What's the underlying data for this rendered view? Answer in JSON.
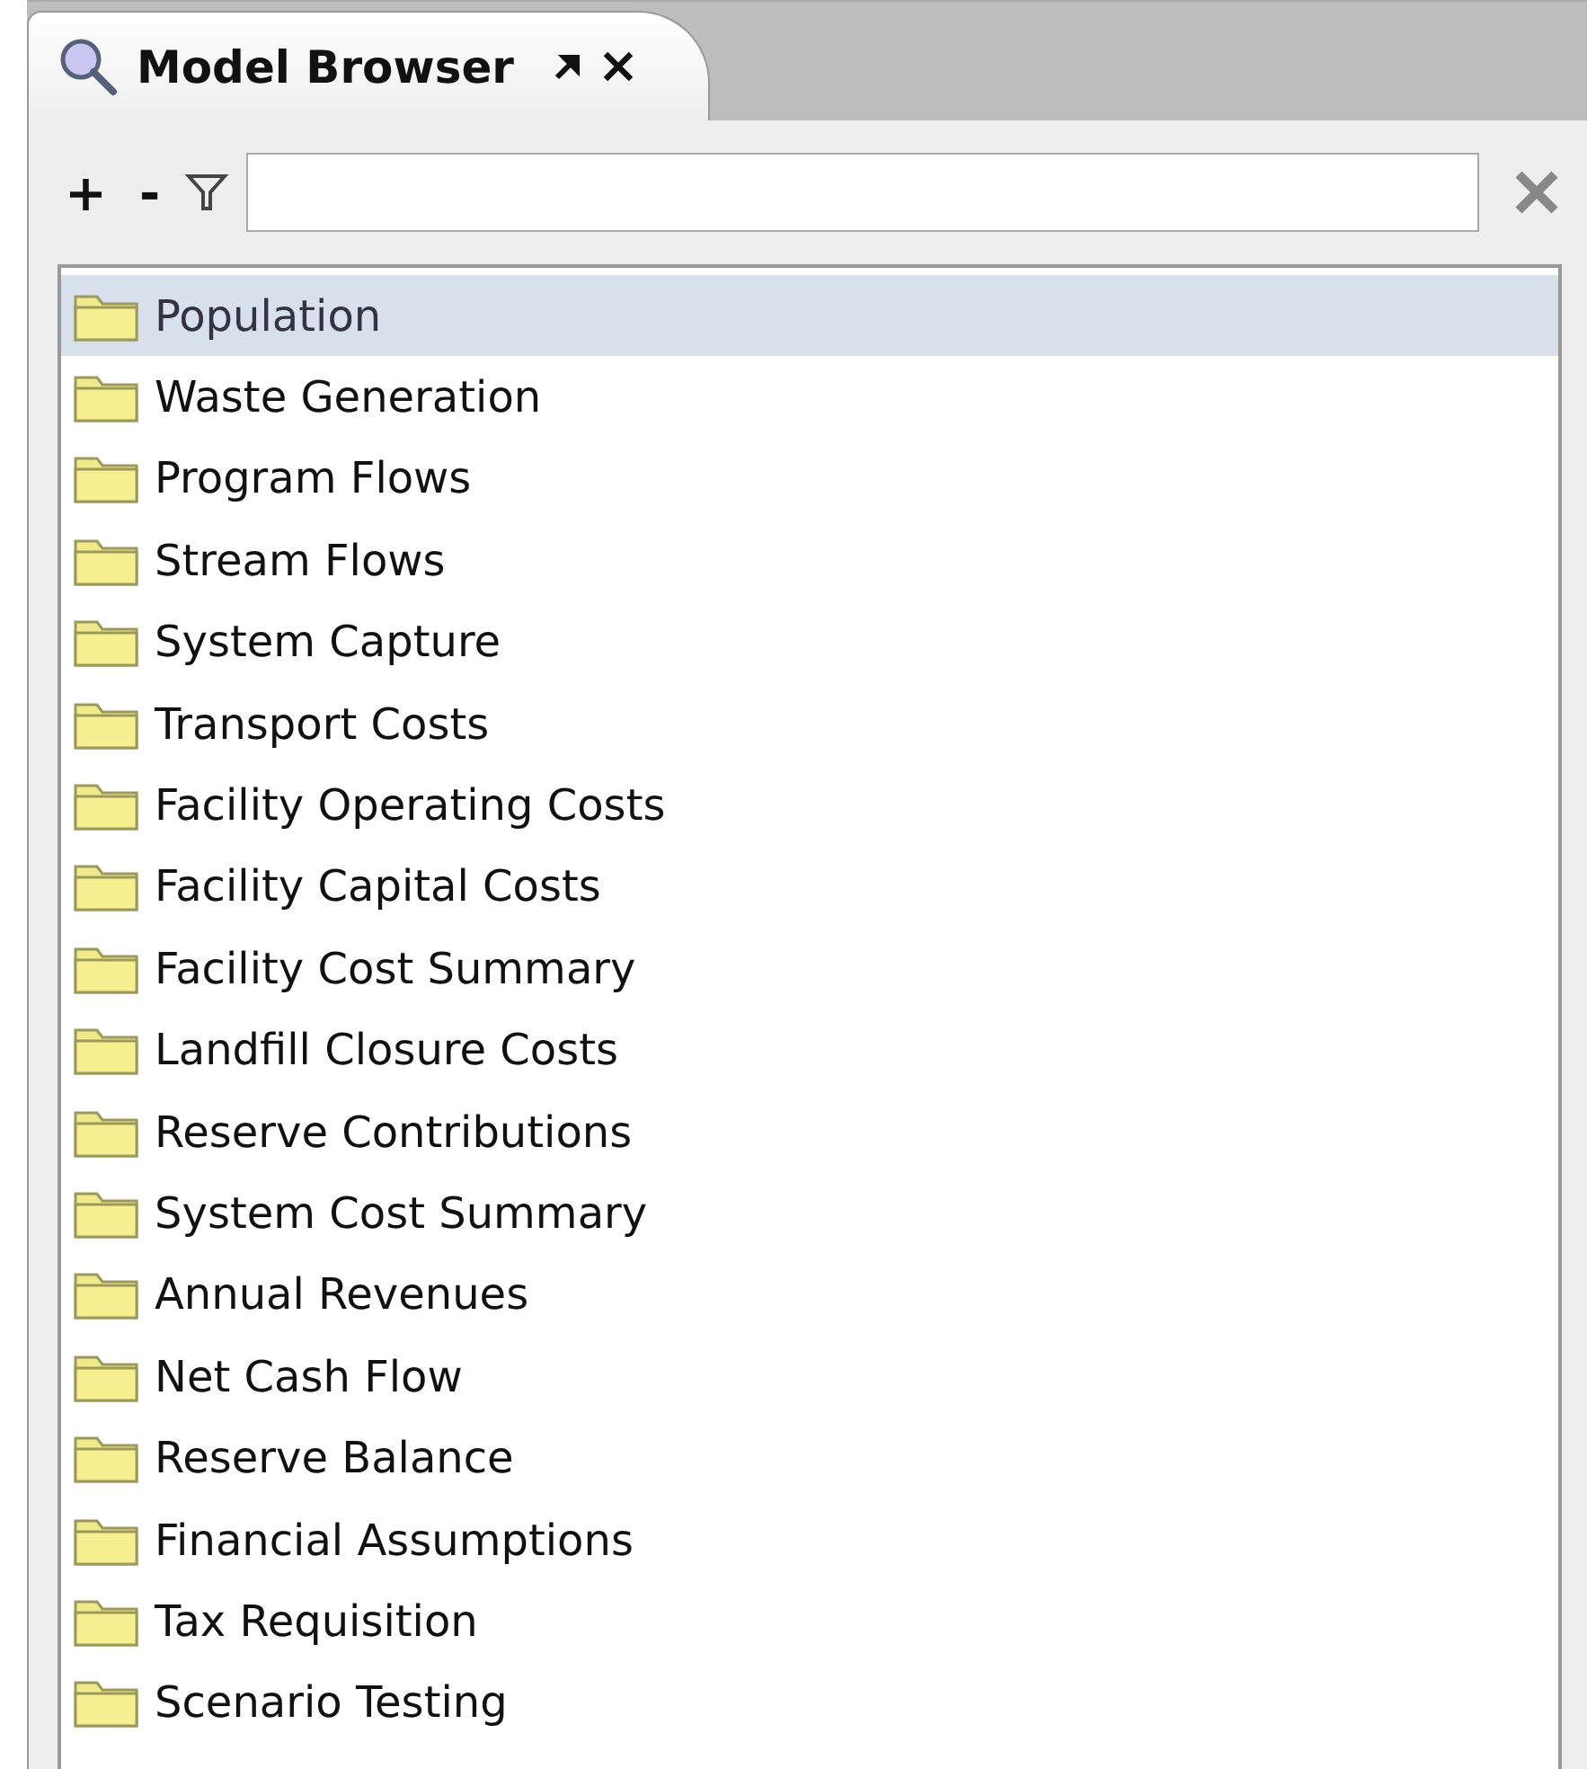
{
  "tab": {
    "title": "Model Browser",
    "selected": true
  },
  "toolbar": {
    "expand": "+",
    "collapse": "-"
  },
  "tree": {
    "items": [
      {
        "label": "Population",
        "selected": true
      },
      {
        "label": "Waste Generation",
        "selected": false
      },
      {
        "label": "Program Flows",
        "selected": false
      },
      {
        "label": "Stream Flows",
        "selected": false
      },
      {
        "label": "System Capture",
        "selected": false
      },
      {
        "label": "Transport Costs",
        "selected": false
      },
      {
        "label": "Facility Operating Costs",
        "selected": false
      },
      {
        "label": "Facility Capital Costs",
        "selected": false
      },
      {
        "label": "Facility Cost Summary",
        "selected": false
      },
      {
        "label": "Landfill Closure Costs",
        "selected": false
      },
      {
        "label": "Reserve Contributions",
        "selected": false
      },
      {
        "label": "System Cost Summary",
        "selected": false
      },
      {
        "label": "Annual Revenues",
        "selected": false
      },
      {
        "label": "Net Cash Flow",
        "selected": false
      },
      {
        "label": "Reserve Balance",
        "selected": false
      },
      {
        "label": "Financial Assumptions",
        "selected": false
      },
      {
        "label": "Tax Requisition",
        "selected": false
      },
      {
        "label": "Scenario Testing",
        "selected": false
      }
    ]
  }
}
